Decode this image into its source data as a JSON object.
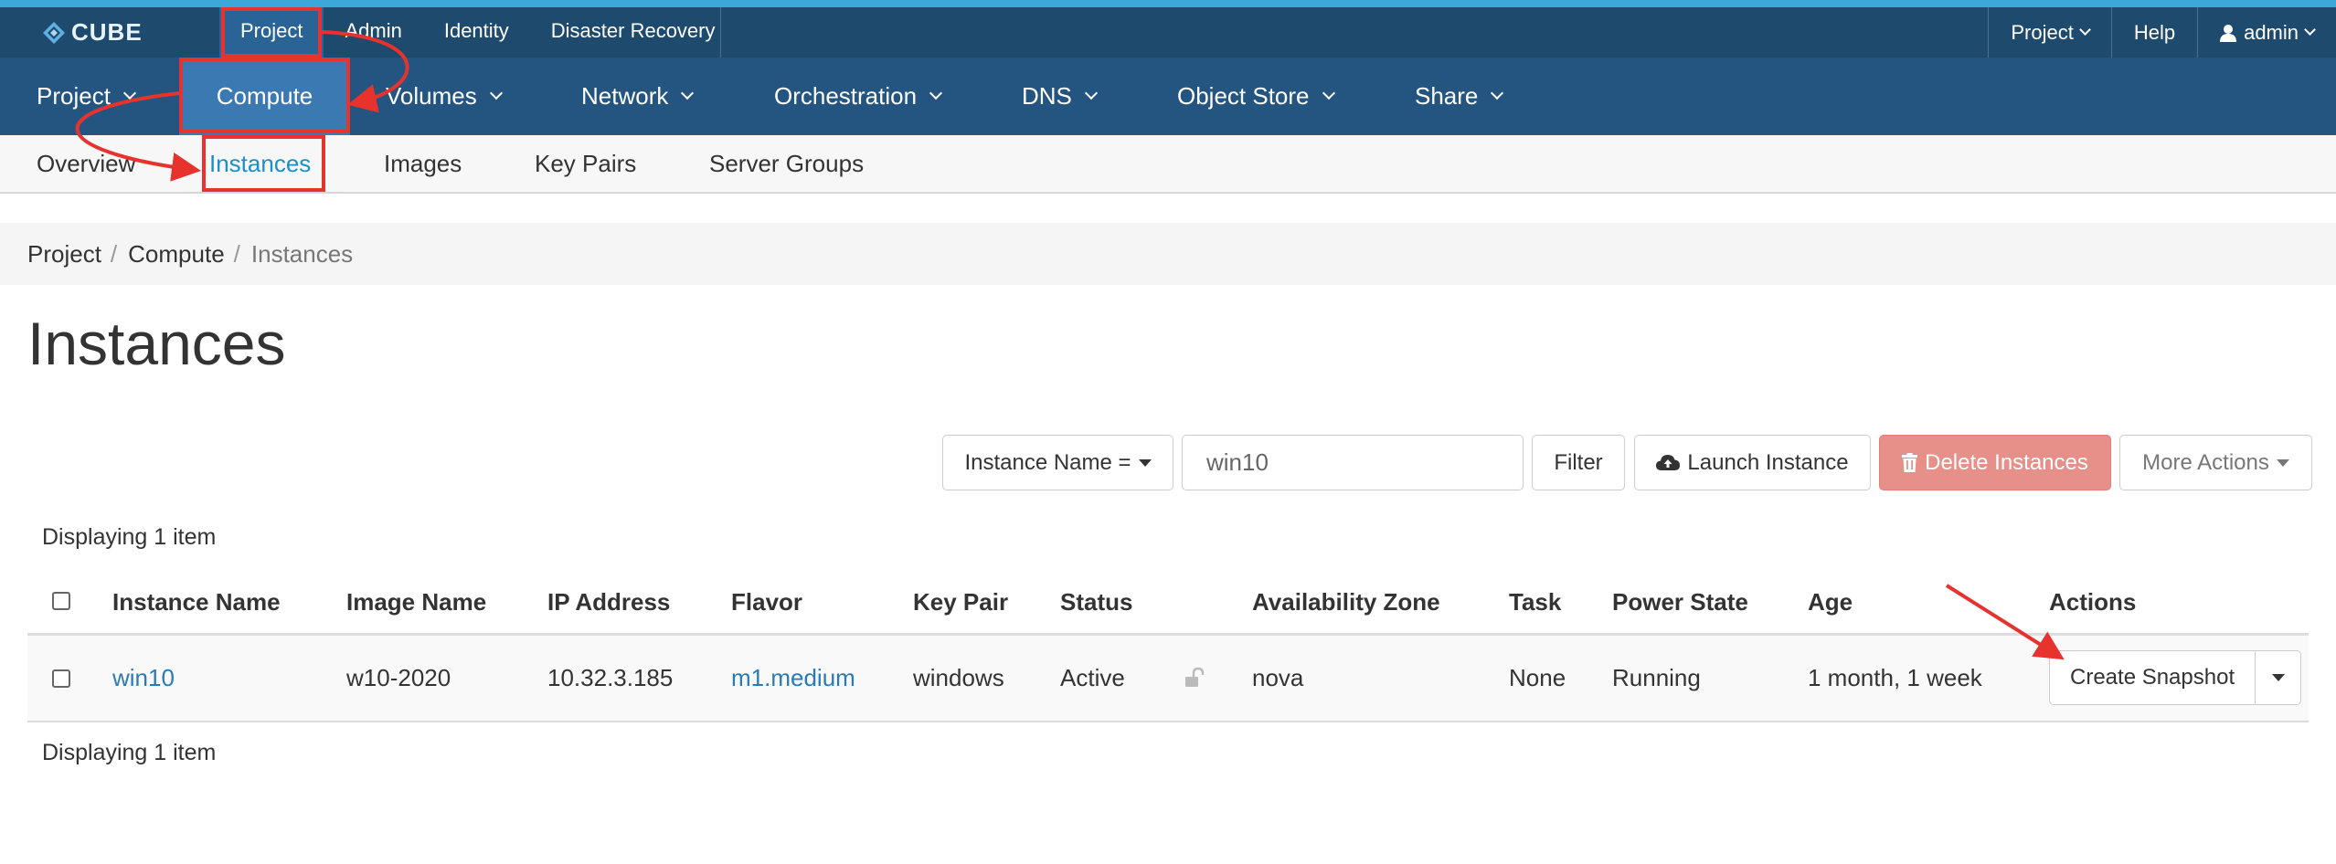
{
  "brand": {
    "name": "CUBE"
  },
  "topnav": {
    "items": [
      {
        "label": "Project",
        "active": true
      },
      {
        "label": "Admin"
      },
      {
        "label": "Identity"
      },
      {
        "label": "Disaster Recovery"
      }
    ],
    "right": {
      "project_label": "Project",
      "help_label": "Help",
      "user_label": "admin"
    }
  },
  "mainnav": {
    "items": [
      {
        "label": "Project"
      },
      {
        "label": "Compute",
        "active": true
      },
      {
        "label": "Volumes"
      },
      {
        "label": "Network"
      },
      {
        "label": "Orchestration"
      },
      {
        "label": "DNS"
      },
      {
        "label": "Object Store"
      },
      {
        "label": "Share"
      }
    ]
  },
  "subnav": {
    "items": [
      {
        "label": "Overview"
      },
      {
        "label": "Instances",
        "active": true
      },
      {
        "label": "Images"
      },
      {
        "label": "Key Pairs"
      },
      {
        "label": "Server Groups"
      }
    ]
  },
  "breadcrumb": [
    "Project",
    "Compute",
    "Instances"
  ],
  "page_title": "Instances",
  "actions": {
    "filter_field_label": "Instance Name =",
    "filter_value": "win10",
    "filter_button": "Filter",
    "launch_button": "Launch Instance",
    "delete_button": "Delete Instances",
    "more_actions": "More Actions"
  },
  "table": {
    "count_top": "Displaying 1 item",
    "count_bottom": "Displaying 1 item",
    "columns": [
      "Instance Name",
      "Image Name",
      "IP Address",
      "Flavor",
      "Key Pair",
      "Status",
      "Availability Zone",
      "Task",
      "Power State",
      "Age",
      "Actions"
    ],
    "rows": [
      {
        "instance_name": "win10",
        "image_name": "w10-2020",
        "ip_address": "10.32.3.185",
        "flavor": "m1.medium",
        "key_pair": "windows",
        "status": "Active",
        "availability_zone": "nova",
        "task": "None",
        "power_state": "Running",
        "age": "1 month, 1 week",
        "action_label": "Create Snapshot"
      }
    ]
  },
  "colors": {
    "topbar": "#1e4a6e",
    "mainnav": "#245580",
    "active_nav": "#3b79b2",
    "link": "#2a7ab5",
    "danger": "#e69089",
    "annotation": "#e8322e"
  }
}
